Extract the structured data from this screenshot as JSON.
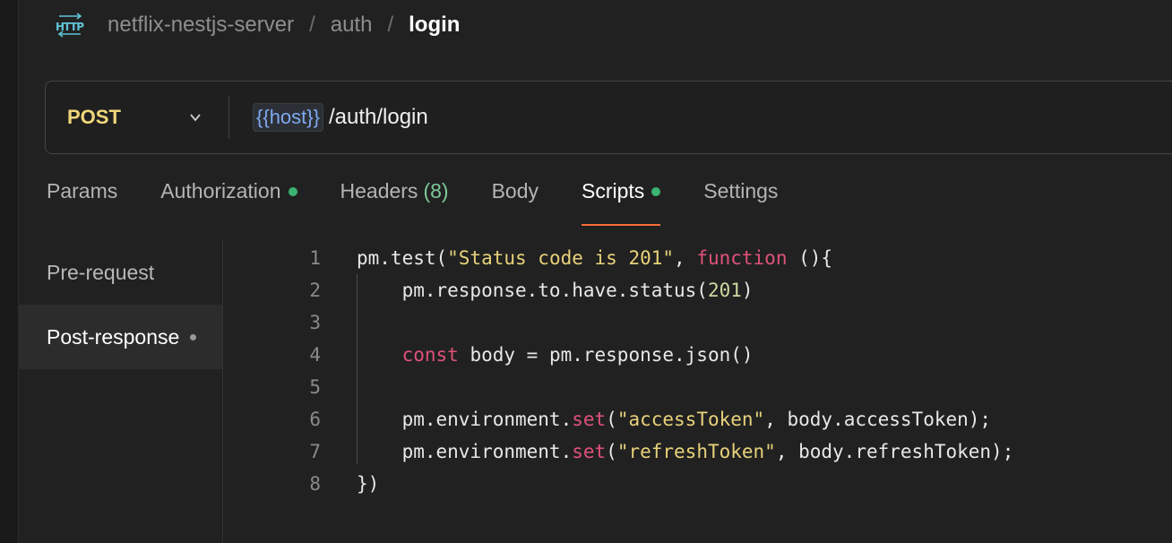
{
  "breadcrumb": {
    "icon": "http-icon",
    "collection": "netflix-nestjs-server",
    "separator": "/",
    "folder": "auth",
    "request": "login"
  },
  "request": {
    "method": "POST",
    "variable": "{{host}}",
    "path": "/auth/login"
  },
  "tabs": [
    {
      "label": "Params"
    },
    {
      "label": "Authorization",
      "dot": true
    },
    {
      "label": "Headers",
      "count": "(8)"
    },
    {
      "label": "Body"
    },
    {
      "label": "Scripts",
      "dot": true,
      "active": true
    },
    {
      "label": "Settings"
    }
  ],
  "script_menu": [
    {
      "label": "Pre-request"
    },
    {
      "label": "Post-response",
      "selected": true
    }
  ],
  "code_lines": [
    {
      "num": "1",
      "segments": [
        [
          "t",
          "pm.test("
        ],
        [
          "s",
          "\"Status code is 201\""
        ],
        [
          "t",
          ", "
        ],
        [
          "k",
          "function"
        ],
        [
          "t",
          " (){"
        ]
      ]
    },
    {
      "num": "2",
      "segments": [
        [
          "t",
          "    pm.response.to.have.status("
        ],
        [
          "n",
          "201"
        ],
        [
          "t",
          ")"
        ]
      ]
    },
    {
      "num": "3",
      "segments": []
    },
    {
      "num": "4",
      "segments": [
        [
          "t",
          "    "
        ],
        [
          "k",
          "const"
        ],
        [
          "t",
          " body = pm.response.json()"
        ]
      ]
    },
    {
      "num": "5",
      "segments": []
    },
    {
      "num": "6",
      "segments": [
        [
          "t",
          "    pm.environment."
        ],
        [
          "k",
          "set"
        ],
        [
          "t",
          "("
        ],
        [
          "s",
          "\"accessToken\""
        ],
        [
          "t",
          ", body.accessToken);"
        ]
      ]
    },
    {
      "num": "7",
      "segments": [
        [
          "t",
          "    pm.environment."
        ],
        [
          "k",
          "set"
        ],
        [
          "t",
          "("
        ],
        [
          "s",
          "\"refreshToken\""
        ],
        [
          "t",
          ", body.refreshToken);"
        ]
      ]
    },
    {
      "num": "8",
      "segments": [
        [
          "t",
          "})"
        ]
      ]
    }
  ],
  "colors": {
    "accent": "#ff6c37",
    "method": "#f0d77a",
    "variable": "#7eaaf0",
    "dot_green": "#3cb371"
  }
}
